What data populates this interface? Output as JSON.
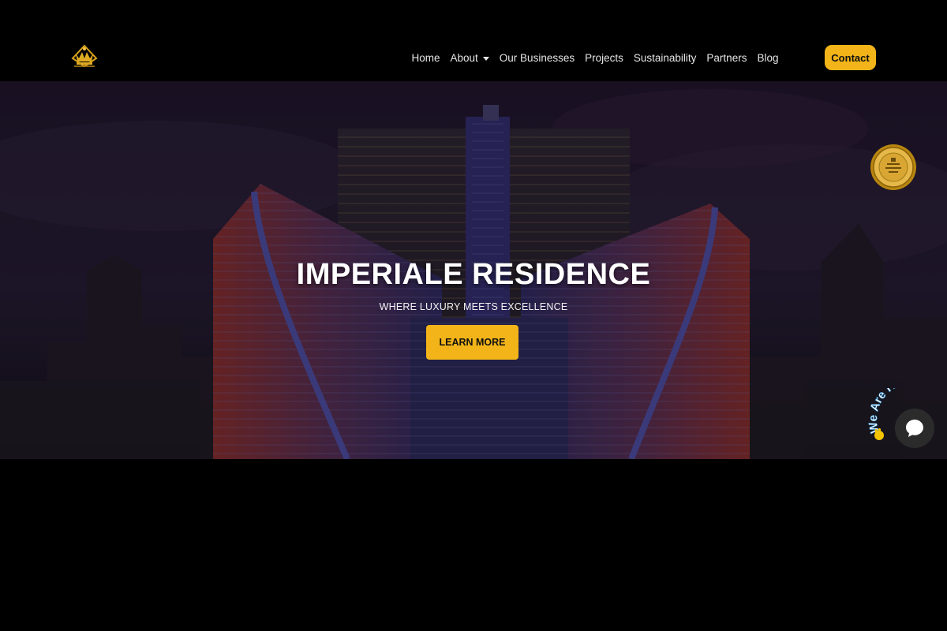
{
  "nav": {
    "logo_icon": "crown-crest-logo",
    "items": [
      {
        "label": "Home"
      },
      {
        "label": "About",
        "has_dropdown": true
      },
      {
        "label": "Our Businesses"
      },
      {
        "label": "Projects"
      },
      {
        "label": "Sustainability"
      },
      {
        "label": "Partners"
      },
      {
        "label": "Blog"
      }
    ],
    "contact_label": "Contact"
  },
  "hero": {
    "title": "IMPERIALE RESIDENCE",
    "subtitle": "WHERE LUXURY MEETS EXCELLENCE",
    "cta_label": "LEARN MORE"
  },
  "badge": {
    "icon": "gold-award-seal"
  },
  "chat": {
    "label": "We Are Here!",
    "icon": "chat-bubble-icon",
    "wave_icon": "waving-hand-icon"
  },
  "colors": {
    "accent": "#f2b418",
    "navbar_bg": "#000000",
    "page_bg": "#000000",
    "hero_sky": "#2a1d38"
  }
}
